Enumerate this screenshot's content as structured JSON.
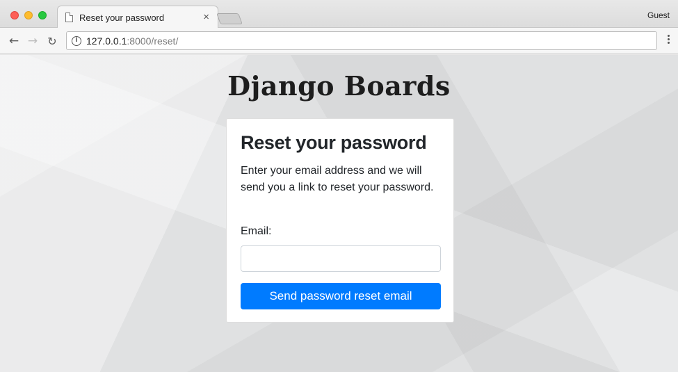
{
  "browser": {
    "tab_title": "Reset your password",
    "tab_close": "×",
    "profile": "Guest",
    "url_host": "127.0.0.1",
    "url_path": ":8000/reset/",
    "back_glyph": "←",
    "forward_glyph": "→",
    "reload_glyph": "↻",
    "info_glyph": "i"
  },
  "page": {
    "brand": "Django Boards",
    "card": {
      "title": "Reset your password",
      "description": "Enter your email address and we will send you a link to reset your password.",
      "email_label": "Email:",
      "email_value": "",
      "email_placeholder": "",
      "submit_label": "Send password reset email"
    }
  },
  "colors": {
    "primary_button": "#007bff",
    "page_background": "#e0e1e2",
    "card_background": "#ffffff"
  },
  "icons": {
    "tab": "document-icon",
    "back": "arrow-left-icon",
    "forward": "arrow-right-icon",
    "reload": "reload-icon",
    "info": "info-icon",
    "menu": "kebab-menu-icon"
  }
}
